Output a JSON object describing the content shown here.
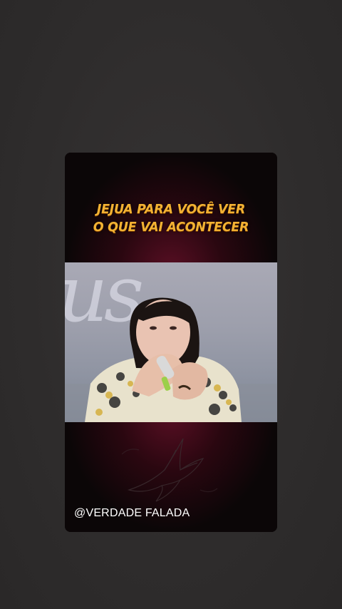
{
  "story": {
    "headline_line1": "JEJUA PARA VOCÊ VER",
    "headline_line2": "O QUE VAI ACONTECER",
    "handle": "@VERDADE FALADA",
    "video_background_text": "us",
    "colors": {
      "background": "#2f2d2d",
      "card": "#0b0607",
      "glow": "#5a0f24",
      "headline": "#f2b233",
      "handle": "#ffffff"
    },
    "icons": [
      "dove-watermark-icon"
    ]
  }
}
